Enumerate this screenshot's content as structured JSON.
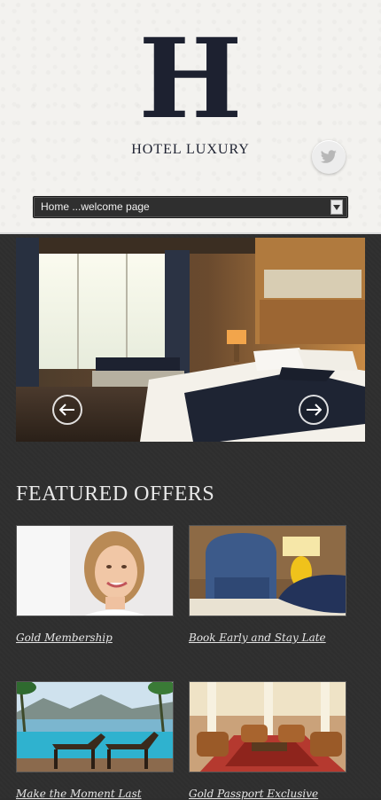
{
  "header": {
    "logo_letter": "H",
    "logo_text": "HOTEL LUXURY",
    "nav_select_value": "Home ...welcome page"
  },
  "icons": {
    "twitter": "twitter-icon",
    "dropdown": "dropdown-arrow-icon",
    "prev": "arrow-left-icon",
    "next": "arrow-right-icon"
  },
  "featured": {
    "title": "FEATURED OFFERS",
    "offers": [
      {
        "label": "Gold Membership"
      },
      {
        "label": "Book Early and Stay Late"
      },
      {
        "label": "Make the Moment Last"
      },
      {
        "label": "Gold Passport Exclusive"
      }
    ]
  },
  "colors": {
    "logo": "#1d2130",
    "background_dark": "#2e2e2e",
    "header_bg": "#f3f2ef"
  }
}
